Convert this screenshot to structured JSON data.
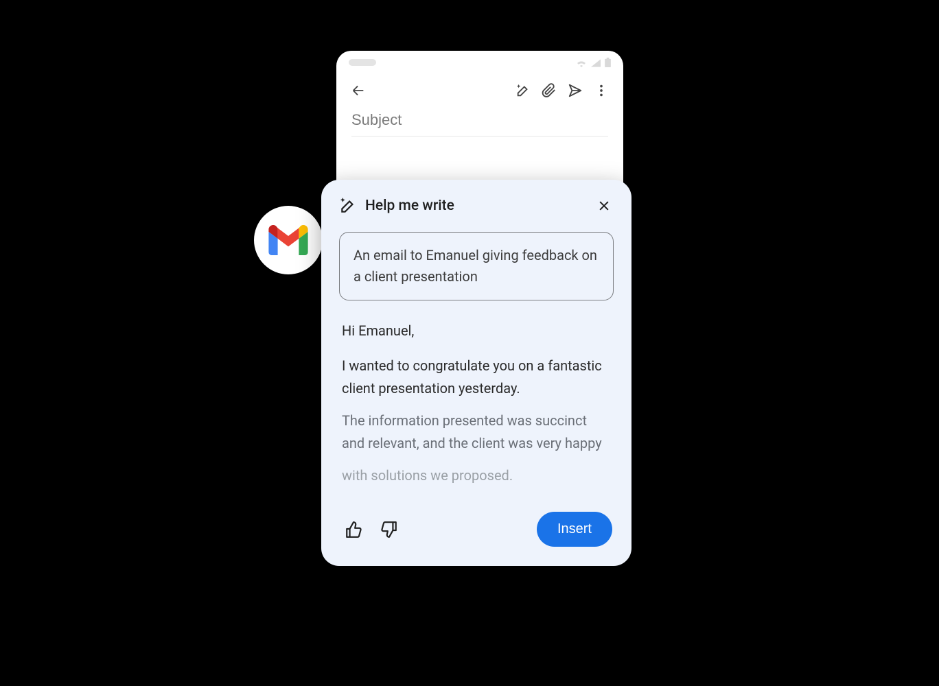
{
  "compose": {
    "subject_placeholder": "Subject"
  },
  "panel": {
    "title": "Help me write",
    "prompt": "An email to Emanuel giving feedback on a client presentation",
    "generated": {
      "greeting": "Hi Emanuel,",
      "line1": "I wanted to congratulate you on a fantastic client presentation yesterday.",
      "line2": "The information presented was succinct and relevant, and the client was very happy",
      "line3": "with solutions we proposed."
    },
    "insert_label": "Insert"
  }
}
